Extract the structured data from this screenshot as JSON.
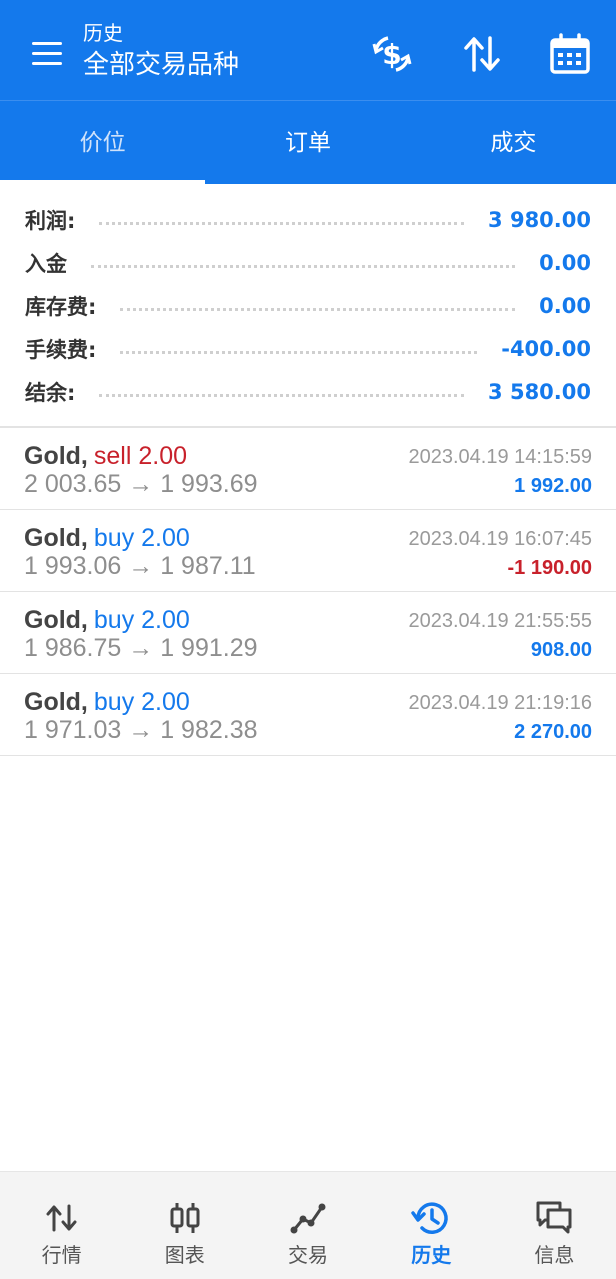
{
  "header": {
    "title_small": "历史",
    "title_big": "全部交易品种",
    "icons": [
      "menu-icon",
      "currency-exchange-icon",
      "sort-icon",
      "calendar-icon"
    ]
  },
  "tabs": [
    {
      "label": "价位",
      "active": true
    },
    {
      "label": "订单",
      "active": false
    },
    {
      "label": "成交",
      "active": false
    }
  ],
  "summary": [
    {
      "label": "利润:",
      "value": "3 980.00"
    },
    {
      "label": "入金",
      "value": "0.00"
    },
    {
      "label": "库存费:",
      "value": "0.00"
    },
    {
      "label": "手续费:",
      "value": "-400.00"
    },
    {
      "label": "结余:",
      "value": "3 580.00"
    }
  ],
  "deals": [
    {
      "symbol": "Gold,",
      "side": "sell 2.00",
      "side_type": "sell",
      "prices": "2 003.65 → 1 993.69",
      "time": "2023.04.19 14:15:59",
      "profit": "1 992.00",
      "profit_sign": "pos"
    },
    {
      "symbol": "Gold,",
      "side": "buy 2.00",
      "side_type": "buy",
      "prices": "1 993.06 → 1 987.11",
      "time": "2023.04.19 16:07:45",
      "profit": "-1 190.00",
      "profit_sign": "neg"
    },
    {
      "symbol": "Gold,",
      "side": "buy 2.00",
      "side_type": "buy",
      "prices": "1 986.75 → 1 991.29",
      "time": "2023.04.19 21:55:55",
      "profit": "908.00",
      "profit_sign": "pos"
    },
    {
      "symbol": "Gold,",
      "side": "buy 2.00",
      "side_type": "buy",
      "prices": "1 971.03 → 1 982.38",
      "time": "2023.04.19 21:19:16",
      "profit": "2 270.00",
      "profit_sign": "pos"
    }
  ],
  "bottom_nav": [
    {
      "label": "行情",
      "icon": "quotes-icon",
      "active": false
    },
    {
      "label": "图表",
      "icon": "chart-icon",
      "active": false
    },
    {
      "label": "交易",
      "icon": "trade-icon",
      "active": false
    },
    {
      "label": "历史",
      "icon": "history-icon",
      "active": true
    },
    {
      "label": "信息",
      "icon": "messages-icon",
      "active": false
    }
  ],
  "colors": {
    "primary": "#1479EC",
    "negative": "#C8212B",
    "muted": "#8e8e8e"
  }
}
